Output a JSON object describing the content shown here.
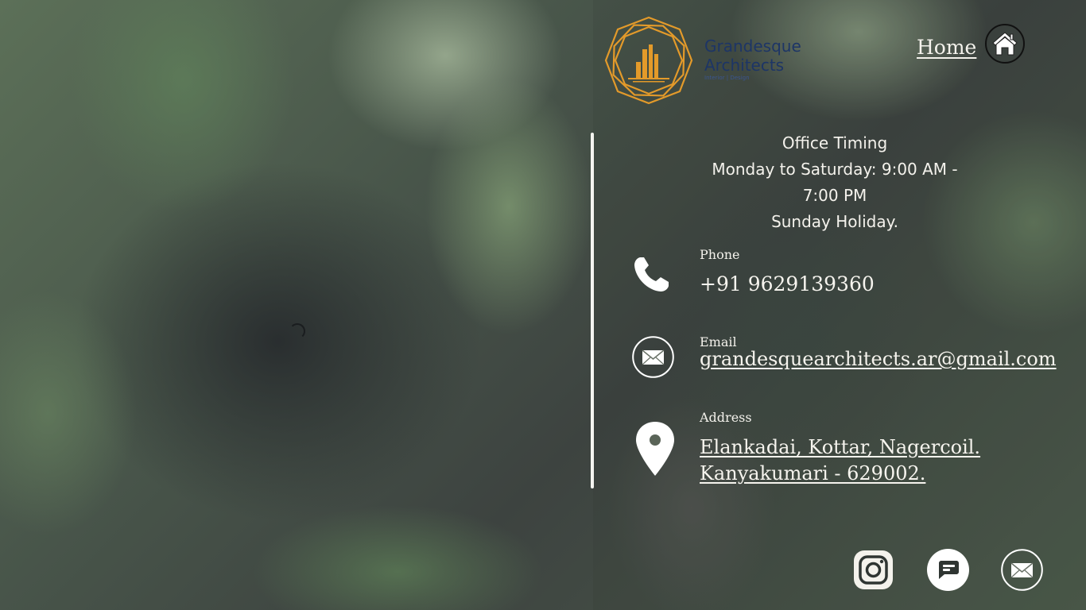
{
  "brand": {
    "name_line1": "Grandesque",
    "name_line2": "Architects",
    "tagline": "Interior | Design",
    "colors": {
      "logo_mark": "#e39a2a",
      "logo_text": "#1d3566"
    }
  },
  "nav": {
    "home_label": "Home",
    "home_icon": "house-icon"
  },
  "office_timing": {
    "heading": "Office Timing",
    "hours": "Monday to Saturday: 9:00 AM - 7:00 PM",
    "holiday": "Sunday Holiday."
  },
  "contact": {
    "phone": {
      "label": "Phone",
      "value": "+91 9629139360",
      "icon": "phone-icon"
    },
    "email": {
      "label": "Email",
      "value": "grandesquearchitects.ar@gmail.com",
      "icon": "envelope-icon"
    },
    "address": {
      "label": "Address",
      "line1": "Elankadai, Kottar, Nagercoil.",
      "line2": "Kanyakumari - 629002.",
      "icon": "map-pin-icon"
    }
  },
  "social": [
    {
      "name": "instagram",
      "icon": "instagram-icon"
    },
    {
      "name": "chat",
      "icon": "chat-bubble-icon"
    },
    {
      "name": "email",
      "icon": "envelope-icon"
    }
  ],
  "theme": {
    "text": "#f4f2ec",
    "divider": "#f4f4f0"
  }
}
